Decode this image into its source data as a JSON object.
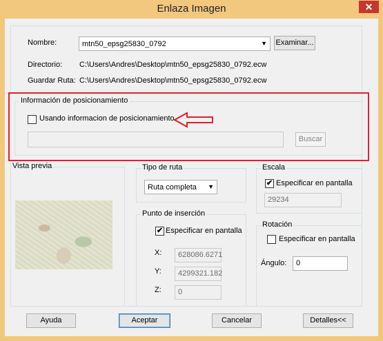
{
  "window": {
    "title": "Enlaza Imagen",
    "close_glyph": "✕"
  },
  "fields": {
    "nombre_label": "Nombre:",
    "nombre_value": "mtn50_epsg25830_0792",
    "examinar_button": "Examinar...",
    "directorio_label": "Directorio:",
    "directorio_value": "C:\\Users\\Andres\\Desktop\\mtn50_epsg25830_0792.ecw",
    "guardar_label": "Guardar Ruta:",
    "guardar_value": "C:\\Users\\Andres\\Desktop\\mtn50_epsg25830_0792.ecw"
  },
  "posicionamiento": {
    "title": "Información de posicionamiento",
    "checkbox_label": "Usando informacion de posicionamiento",
    "checked": false,
    "input_value": "",
    "buscar_button": "Buscar"
  },
  "vista_previa": {
    "title": "Vista previa"
  },
  "tipo_ruta": {
    "title": "Tipo de ruta",
    "selected": "Ruta completa"
  },
  "punto_insercion": {
    "title": "Punto de inserción",
    "checkbox_label": "Especificar en pantalla",
    "checked": true,
    "x_label": "X:",
    "x_value": "628086.6271",
    "y_label": "Y:",
    "y_value": "4299321.182",
    "z_label": "Z:",
    "z_value": "0"
  },
  "escala": {
    "title": "Escala",
    "checkbox_label": "Especificar en pantalla",
    "checked": true,
    "value": "29234"
  },
  "rotacion": {
    "title": "Rotación",
    "checkbox_label": "Especificar en pantalla",
    "checked": false,
    "angulo_label": "Ángulo:",
    "angulo_value": "0"
  },
  "buttons": {
    "ayuda": "Ayuda",
    "aceptar": "Aceptar",
    "cancelar": "Cancelar",
    "detalles": "Detalles<<"
  },
  "colors": {
    "title_bar": "#f2c77e",
    "annotation_red": "#e0202a"
  },
  "glyphs": {
    "checkmark": "✔",
    "dropdown": "▼"
  }
}
